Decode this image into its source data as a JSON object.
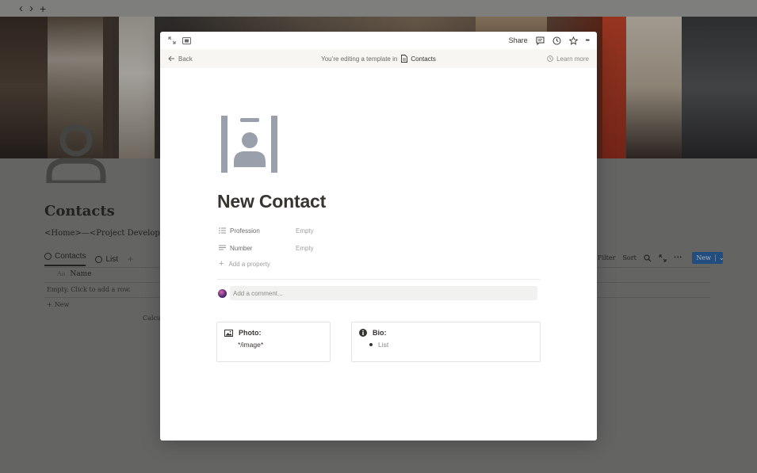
{
  "browser": {
    "back_glyph": "‹",
    "forward_glyph": "›",
    "new_tab_glyph": "+"
  },
  "background": {
    "title": "Contacts",
    "breadcrumb": "<Home>—<Project Development>—<N",
    "tabs": [
      {
        "label": "Contacts",
        "active": true
      },
      {
        "label": "List",
        "active": false
      }
    ],
    "add_tab_glyph": "+",
    "column_header_icon": "Aa",
    "column_header": "Name",
    "empty_text": "Empty. Click to add a row.",
    "new_row_label": "New",
    "calculate_label": "Calcul",
    "toolbar": {
      "filter": "Filter",
      "sort": "Sort",
      "more": "•••",
      "new_button": "New",
      "new_caret": "⌄"
    }
  },
  "modal": {
    "top": {
      "share": "Share",
      "more": "•••"
    },
    "template_bar": {
      "back": "Back",
      "editing_text": "You’re editing a template in",
      "page_link": "Contacts",
      "learn_more": "Learn more"
    },
    "page": {
      "title": "New Contact",
      "properties": [
        {
          "name": "Profession",
          "value": "Empty",
          "icon": "list-icon"
        },
        {
          "name": "Number",
          "value": "Empty",
          "icon": "text-icon"
        }
      ],
      "add_property": "Add a property",
      "comment_placeholder": "Add a comment...",
      "callouts": [
        {
          "title": "Photo:",
          "body": "*/image*",
          "icon": "image-icon"
        },
        {
          "title": "Bio:",
          "bullet": "List",
          "icon": "info-icon"
        }
      ]
    }
  },
  "colors": {
    "accent_button": "#2a6ab7",
    "overlay": "#0f0f0f",
    "text": "#37352f",
    "muted": "#a0a09c"
  }
}
